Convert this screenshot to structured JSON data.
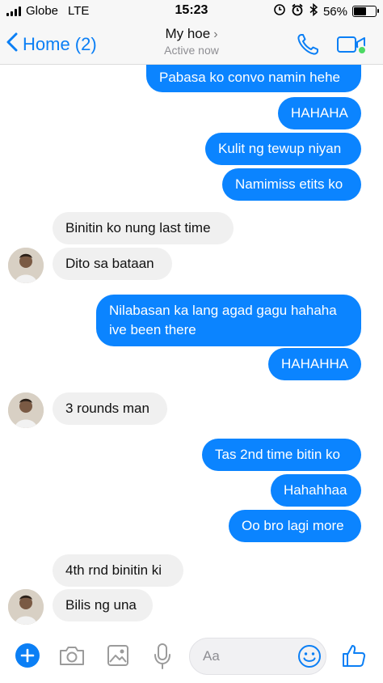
{
  "status_bar": {
    "carrier": "Globe",
    "network": "LTE",
    "time": "15:23",
    "battery": "56%",
    "battery_level": 0.56
  },
  "header": {
    "back_label": "Home (2)",
    "contact_name": "My hoe",
    "chevron": "›",
    "subtitle": "Active now"
  },
  "messages": [
    {
      "side": "out",
      "text": "Pabasa ko convo namin hehe"
    },
    {
      "side": "out",
      "text": "HAHAHA"
    },
    {
      "side": "out",
      "text": "Kulit ng tewup niyan"
    },
    {
      "side": "out",
      "text": "Namimiss etits ko"
    },
    {
      "side": "in",
      "text": "Binitin ko nung last time"
    },
    {
      "side": "in",
      "text": "Dito sa bataan"
    },
    {
      "side": "out",
      "text": "Nilabasan ka lang agad gagu hahaha ive been there"
    },
    {
      "side": "out",
      "text": "HAHAHHA"
    },
    {
      "side": "in",
      "text": "3 rounds man"
    },
    {
      "side": "out",
      "text": "Tas 2nd time bitin ko"
    },
    {
      "side": "out",
      "text": "Hahahhaa"
    },
    {
      "side": "out",
      "text": "Oo bro lagi more"
    },
    {
      "side": "in",
      "text": "4th rnd binitin ki"
    },
    {
      "side": "in",
      "text": "Bilis ng una"
    }
  ],
  "composer": {
    "placeholder": "Aa"
  },
  "colors": {
    "accent": "#0b84ff",
    "incoming_bubble": "#f0f0f0",
    "header_bg": "#f7f7f7"
  },
  "icons": [
    "signal-icon",
    "alarm-icon",
    "bluetooth-icon",
    "battery-icon",
    "back-chevron-icon",
    "phone-icon",
    "video-camera-icon",
    "plus-icon",
    "camera-icon",
    "image-icon",
    "microphone-icon",
    "emoji-icon",
    "thumbs-up-icon"
  ]
}
